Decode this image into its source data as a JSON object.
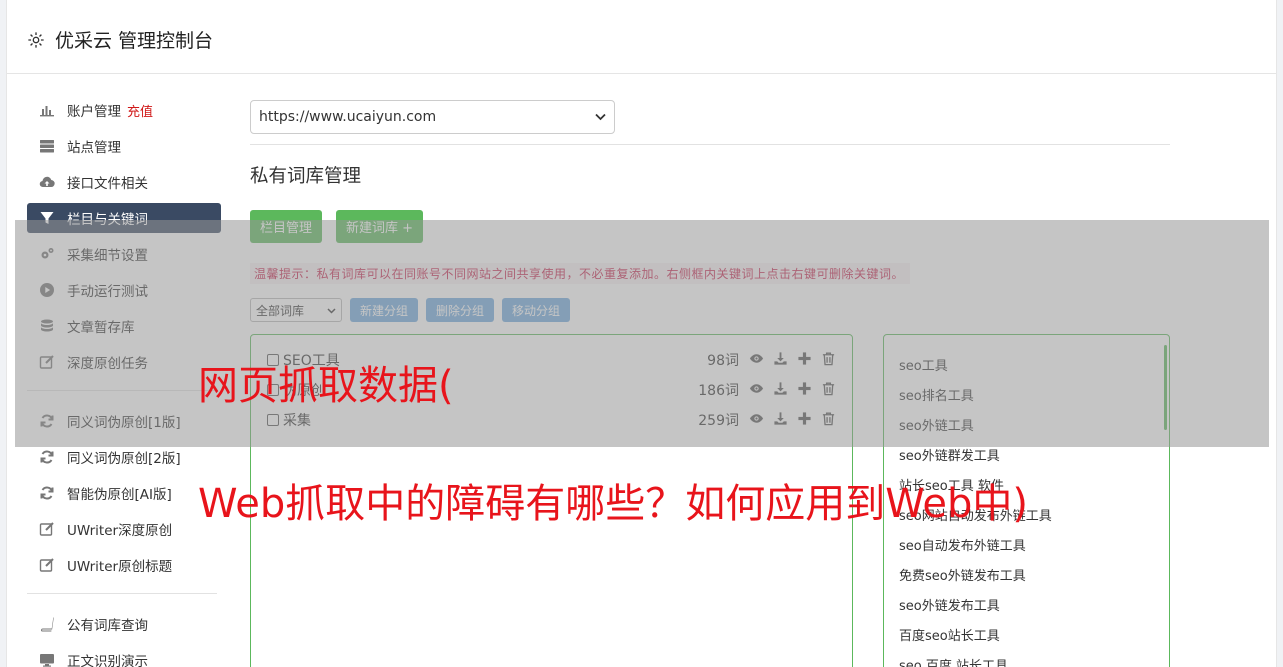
{
  "header": {
    "title": "优采云 管理控制台"
  },
  "sidebar": {
    "items": [
      {
        "label": "账户管理",
        "extra": "充值",
        "icon": "bar-chart-icon"
      },
      {
        "label": "站点管理",
        "icon": "server-icon"
      },
      {
        "label": "接口文件相关",
        "icon": "cloud-upload-icon"
      },
      {
        "label": "栏目与关键词",
        "icon": "filter-icon",
        "active": true
      },
      {
        "label": "采集细节设置",
        "icon": "gears-icon"
      },
      {
        "label": "手动运行测试",
        "icon": "play-circle-icon"
      },
      {
        "label": "文章暂存库",
        "icon": "database-icon"
      },
      {
        "label": "深度原创任务",
        "icon": "edit-icon"
      },
      {
        "label": "同义词伪原创[1版]",
        "icon": "refresh-icon"
      },
      {
        "label": "同义词伪原创[2版]",
        "icon": "refresh-icon"
      },
      {
        "label": "智能伪原创[AI版]",
        "icon": "refresh-icon"
      },
      {
        "label": "UWriter深度原创",
        "icon": "edit-icon"
      },
      {
        "label": "UWriter原创标题",
        "icon": "edit-icon"
      },
      {
        "label": "公有词库查询",
        "icon": "book-icon"
      },
      {
        "label": "正文识别演示",
        "icon": "monitor-icon"
      }
    ]
  },
  "main": {
    "site_select": "https://www.ucaiyun.com",
    "section_title": "私有词库管理",
    "btn_column": "栏目管理",
    "btn_new_lib": "新建词库 +",
    "tip": "温馨提示：私有词库可以在同账号不同网站之间共享使用，不必重复添加。右侧框内关键词上点击右键可删除关键词。",
    "group_select": "全部词库",
    "btn_new_group": "新建分组",
    "btn_del_group": "删除分组",
    "btn_move_group": "移动分组",
    "libraries": [
      {
        "name": "SEO工具",
        "count": "98词"
      },
      {
        "name": "伪原创",
        "count": "186词"
      },
      {
        "name": "采集",
        "count": "259词"
      }
    ],
    "keywords": [
      "seo工具",
      "seo排名工具",
      "seo外链工具",
      "seo外链群发工具",
      "站长seo工具 软件",
      "seo网站自动发布外链工具",
      "seo自动发布外链工具",
      "免费seo外链发布工具",
      "seo外链发布工具",
      "百度seo站长工具",
      "seo 百度 站长工具"
    ]
  },
  "overlay_text": {
    "line1": "网页抓取数据(",
    "line2": "Web抓取中的障碍有哪些？如何应用到Web中)"
  },
  "colors": {
    "accent": "#5cb85c",
    "active_nav": "#3a4a63",
    "overlay_red": "#e8141b",
    "btn_blue": "#6fa9dd"
  }
}
